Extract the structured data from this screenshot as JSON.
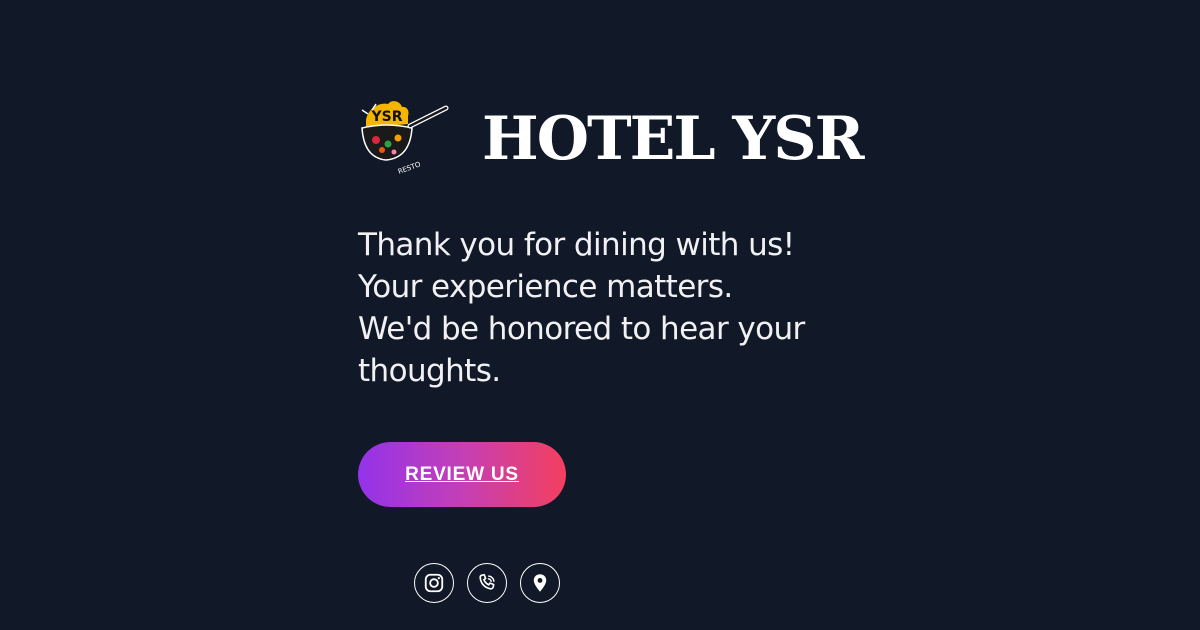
{
  "brand": {
    "name": "HOTEL YSR",
    "logo_text": "YSR",
    "logo_subtext": "RESTO"
  },
  "message": {
    "lines": [
      "Thank you for dining with us!",
      "Your experience matters.",
      "We'd be honored to hear your",
      "thoughts."
    ]
  },
  "cta": {
    "label": "REVIEW US"
  },
  "socials": [
    {
      "icon": "instagram-icon"
    },
    {
      "icon": "phone-icon"
    },
    {
      "icon": "location-pin-icon"
    }
  ],
  "colors": {
    "background": "#111827",
    "text": "#f3f4f6",
    "button_gradient_start": "#9333ea",
    "button_gradient_end": "#f43f5e",
    "logo_accent": "#f5b400"
  }
}
